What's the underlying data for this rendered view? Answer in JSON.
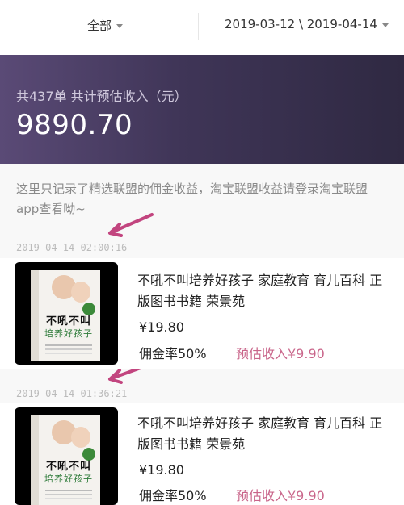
{
  "filters": {
    "category": "全部",
    "date_range": "2019-03-12 \\ 2019-04-14"
  },
  "summary": {
    "label": "共437单 共计预估收入（元）",
    "amount": "9890.70"
  },
  "notice": "这里只记录了精选联盟的佣金收益，淘宝联盟收益请登录淘宝联盟app查看呦~",
  "orders": [
    {
      "timestamp": "2019-04-14 02:00:16",
      "cover_title": "不吼不叫",
      "cover_subtitle": "培养好孩子",
      "title": "不吼不叫培养好孩子 家庭教育 育儿百科 正版图书书籍 荣景苑",
      "price": "¥19.80",
      "commission_rate": "佣金率50%",
      "estimated_income": "预估收入¥9.90"
    },
    {
      "timestamp": "2019-04-14 01:36:21",
      "cover_title": "不吼不叫",
      "cover_subtitle": "培养好孩子",
      "title": "不吼不叫培养好孩子 家庭教育 育儿百科 正版图书书籍 荣景苑",
      "price": "¥19.80",
      "commission_rate": "佣金率50%",
      "estimated_income": "预估收入¥9.90"
    }
  ],
  "colors": {
    "summary_bg": "#3f3557",
    "income_text": "#c9658a",
    "annotation_arrow": "#c2457f"
  },
  "icons": {
    "dropdown": "chevron-down-icon",
    "annotation": "arrow-annotation-icon"
  }
}
